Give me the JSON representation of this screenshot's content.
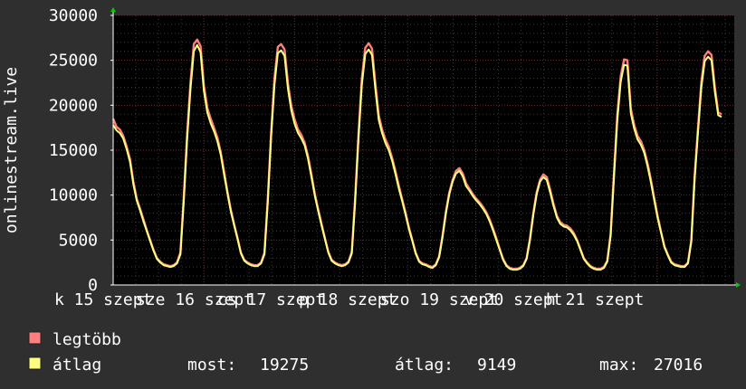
{
  "chart_data": {
    "type": "line",
    "ylabel": "onlinestream.live",
    "ylim": [
      0,
      30000
    ],
    "y_ticks": [
      0,
      5000,
      10000,
      15000,
      20000,
      25000,
      30000
    ],
    "y_tick_labels": [
      "0",
      "5000",
      "10000",
      "15000",
      "20000",
      "25000",
      "30000"
    ],
    "x_tick_labels": [
      "k 15 szept",
      "sze 16 szept",
      "cs 17 szept",
      "p 18 szept",
      "szo 19 szept",
      "v 20 szept",
      "h 21 szept"
    ],
    "grid": true,
    "colors": {
      "background": "#2f2f2f",
      "plot_background": "#000000",
      "grid_minor": "#3a3a3a",
      "grid_major": "#7a2a2a",
      "axis": "#ffffff",
      "series_max": "#ff7f7f",
      "series_avg": "#ffff7f",
      "arrow": "#00cc00"
    },
    "series": [
      {
        "name": "legtöbb",
        "color": "#ff7f7f",
        "values": [
          18500,
          17600,
          17300,
          16600,
          15400,
          14000,
          11500,
          9600,
          8500,
          7300,
          6100,
          5000,
          3900,
          3000,
          2600,
          2300,
          2200,
          2100,
          2200,
          2500,
          3600,
          9800,
          16800,
          22500,
          26800,
          27300,
          26600,
          22200,
          19700,
          18500,
          17500,
          16400,
          14800,
          12600,
          10400,
          8400,
          6700,
          5200,
          3600,
          2800,
          2500,
          2300,
          2200,
          2200,
          2500,
          3600,
          9600,
          17000,
          23000,
          26500,
          26800,
          26200,
          22400,
          19900,
          18400,
          17300,
          16700,
          15800,
          14300,
          12300,
          10100,
          8400,
          6800,
          5200,
          3700,
          2800,
          2500,
          2300,
          2200,
          2300,
          2600,
          3700,
          9700,
          16800,
          23000,
          26400,
          26900,
          26300,
          22400,
          18900,
          17300,
          16200,
          15400,
          14100,
          12600,
          11000,
          9500,
          8000,
          6400,
          5000,
          3600,
          2700,
          2400,
          2300,
          2100,
          2000,
          2300,
          3200,
          5500,
          8200,
          10300,
          11700,
          12700,
          13000,
          12400,
          11300,
          10700,
          10100,
          9600,
          9200,
          8700,
          8100,
          7300,
          6300,
          5200,
          4000,
          2900,
          2200,
          1900,
          1800,
          1800,
          1900,
          2200,
          3000,
          5200,
          8000,
          10300,
          11700,
          12300,
          12000,
          10600,
          9000,
          7700,
          7000,
          6700,
          6600,
          6300,
          5800,
          5000,
          4000,
          3000,
          2500,
          2100,
          1900,
          1800,
          1800,
          2000,
          2700,
          5700,
          12500,
          19000,
          23200,
          25100,
          25000,
          19600,
          17800,
          16600,
          16000,
          15000,
          13500,
          11700,
          9600,
          7600,
          5900,
          4300,
          3400,
          2600,
          2300,
          2200,
          2100,
          2100,
          2500,
          5000,
          12200,
          17500,
          22600,
          25500,
          26000,
          25600,
          22000,
          19200,
          19000
        ]
      },
      {
        "name": "átlag",
        "color": "#ffff7f",
        "values": [
          17800,
          17200,
          16900,
          16300,
          15100,
          13700,
          11200,
          9400,
          8300,
          7100,
          6000,
          4900,
          3800,
          2900,
          2500,
          2200,
          2100,
          2000,
          2100,
          2400,
          3400,
          9300,
          16200,
          21800,
          26000,
          26700,
          25900,
          21600,
          19200,
          18000,
          17100,
          16000,
          14500,
          12300,
          10200,
          8200,
          6600,
          5100,
          3500,
          2700,
          2400,
          2200,
          2100,
          2100,
          2400,
          3400,
          9200,
          16500,
          22300,
          25800,
          26100,
          25500,
          21800,
          19400,
          17900,
          16900,
          16300,
          15500,
          14000,
          12000,
          9900,
          8200,
          6600,
          5100,
          3600,
          2700,
          2400,
          2200,
          2100,
          2200,
          2500,
          3500,
          9300,
          16300,
          22300,
          25700,
          26200,
          25600,
          21800,
          18400,
          16900,
          15800,
          15000,
          13800,
          12300,
          10700,
          9300,
          7800,
          6200,
          4900,
          3500,
          2600,
          2300,
          2200,
          2000,
          1900,
          2200,
          3100,
          5300,
          8000,
          10100,
          11500,
          12400,
          12700,
          12100,
          11000,
          10500,
          9900,
          9400,
          9000,
          8500,
          7900,
          7100,
          6100,
          5000,
          3900,
          2800,
          2100,
          1800,
          1700,
          1700,
          1800,
          2100,
          2900,
          5000,
          7800,
          10100,
          11500,
          12000,
          11700,
          10300,
          8800,
          7500,
          6800,
          6500,
          6400,
          6100,
          5600,
          4900,
          3900,
          2900,
          2400,
          2000,
          1800,
          1700,
          1700,
          1900,
          2600,
          5500,
          12000,
          18400,
          22600,
          24500,
          24400,
          19100,
          17400,
          16200,
          15600,
          14700,
          13200,
          11400,
          9400,
          7400,
          5800,
          4200,
          3300,
          2500,
          2200,
          2100,
          2000,
          2000,
          2400,
          4800,
          11800,
          17000,
          22000,
          24900,
          25400,
          25000,
          21500,
          18900,
          18700
        ]
      }
    ]
  },
  "legend": {
    "items": [
      {
        "label": "legtöbb",
        "color": "#ff7f7f"
      },
      {
        "label": "átlag",
        "color": "#ffff7f"
      }
    ],
    "stats": [
      {
        "label": "most:",
        "value": "19275"
      },
      {
        "label": "átlag:",
        "value": "9149"
      },
      {
        "label": "max:",
        "value": "27016"
      }
    ]
  }
}
